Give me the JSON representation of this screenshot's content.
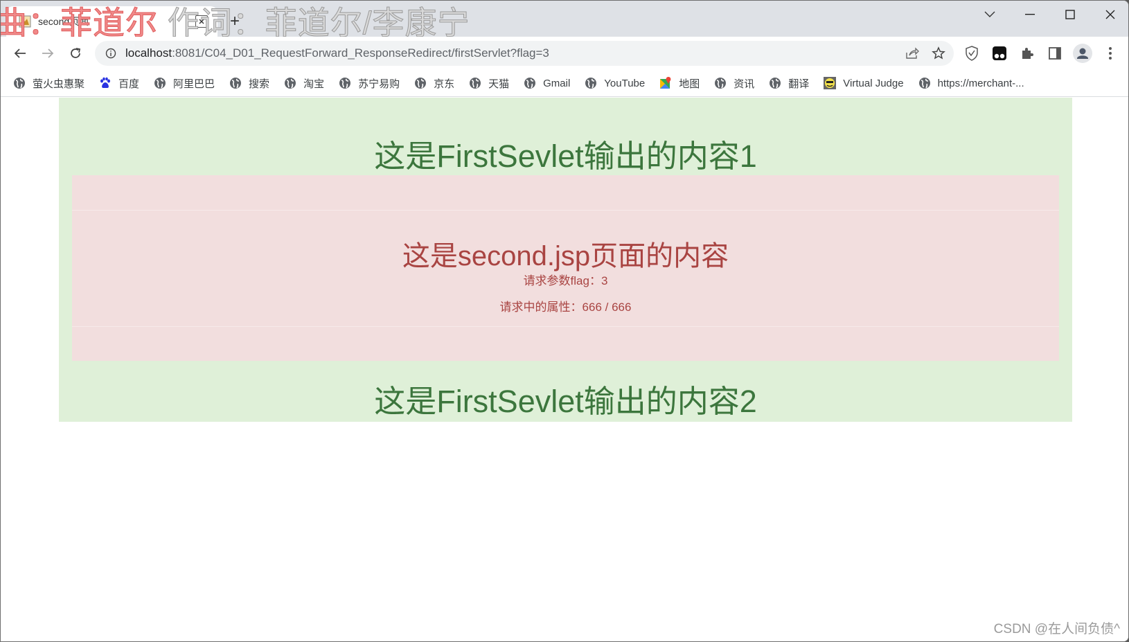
{
  "window": {
    "lyric_overlay": {
      "red_part": "曲：菲道尔 ",
      "gray_part": "作词：菲道尔/李康宁"
    },
    "tab": {
      "title": "second页面",
      "favicon": "tomcat-icon"
    },
    "controls": {
      "tab_search": "chevron-down-icon",
      "minimize": "minimize-icon",
      "maximize": "maximize-icon",
      "close": "close-icon"
    }
  },
  "toolbar": {
    "url_host": "localhost",
    "url_path": ":8081/C04_D01_RequestForward_ResponseRedirect/firstServlet?flag=3",
    "icons": [
      "back-icon",
      "forward-icon",
      "reload-icon",
      "info-icon",
      "share-icon",
      "bookmark-star-icon",
      "shield-extension-icon",
      "tampermonkey-icon",
      "extensions-puzzle-icon",
      "side-panel-icon",
      "profile-avatar-icon",
      "more-menu-icon"
    ]
  },
  "bookmarks": [
    {
      "label": "萤火虫惠聚",
      "icon": "globe-icon"
    },
    {
      "label": "百度",
      "icon": "baidu-paw-icon"
    },
    {
      "label": "阿里巴巴",
      "icon": "globe-icon"
    },
    {
      "label": "搜索",
      "icon": "globe-icon"
    },
    {
      "label": "淘宝",
      "icon": "globe-icon"
    },
    {
      "label": "苏宁易购",
      "icon": "globe-icon"
    },
    {
      "label": "京东",
      "icon": "globe-icon"
    },
    {
      "label": "天猫",
      "icon": "globe-icon"
    },
    {
      "label": "Gmail",
      "icon": "globe-icon"
    },
    {
      "label": "YouTube",
      "icon": "globe-icon"
    },
    {
      "label": "地图",
      "icon": "google-maps-icon"
    },
    {
      "label": "资讯",
      "icon": "globe-icon"
    },
    {
      "label": "翻译",
      "icon": "globe-icon"
    },
    {
      "label": "Virtual Judge",
      "icon": "smiley-icon"
    },
    {
      "label": "https://merchant-...",
      "icon": "globe-icon"
    }
  ],
  "page": {
    "first_heading_1": "这是FirstSevlet输出的内容1",
    "second_heading": "这是second.jsp页面的内容",
    "param_line": "请求参数flag：3",
    "attr_line": "请求中的属性：666 / 666",
    "first_heading_2": "这是FirstSevlet输出的内容2",
    "colors": {
      "success_bg": "#dff0d8",
      "success_text": "#3c763d",
      "danger_bg": "#f2dede",
      "danger_text": "#a94442"
    }
  },
  "watermark": "CSDN @在人间负债^"
}
